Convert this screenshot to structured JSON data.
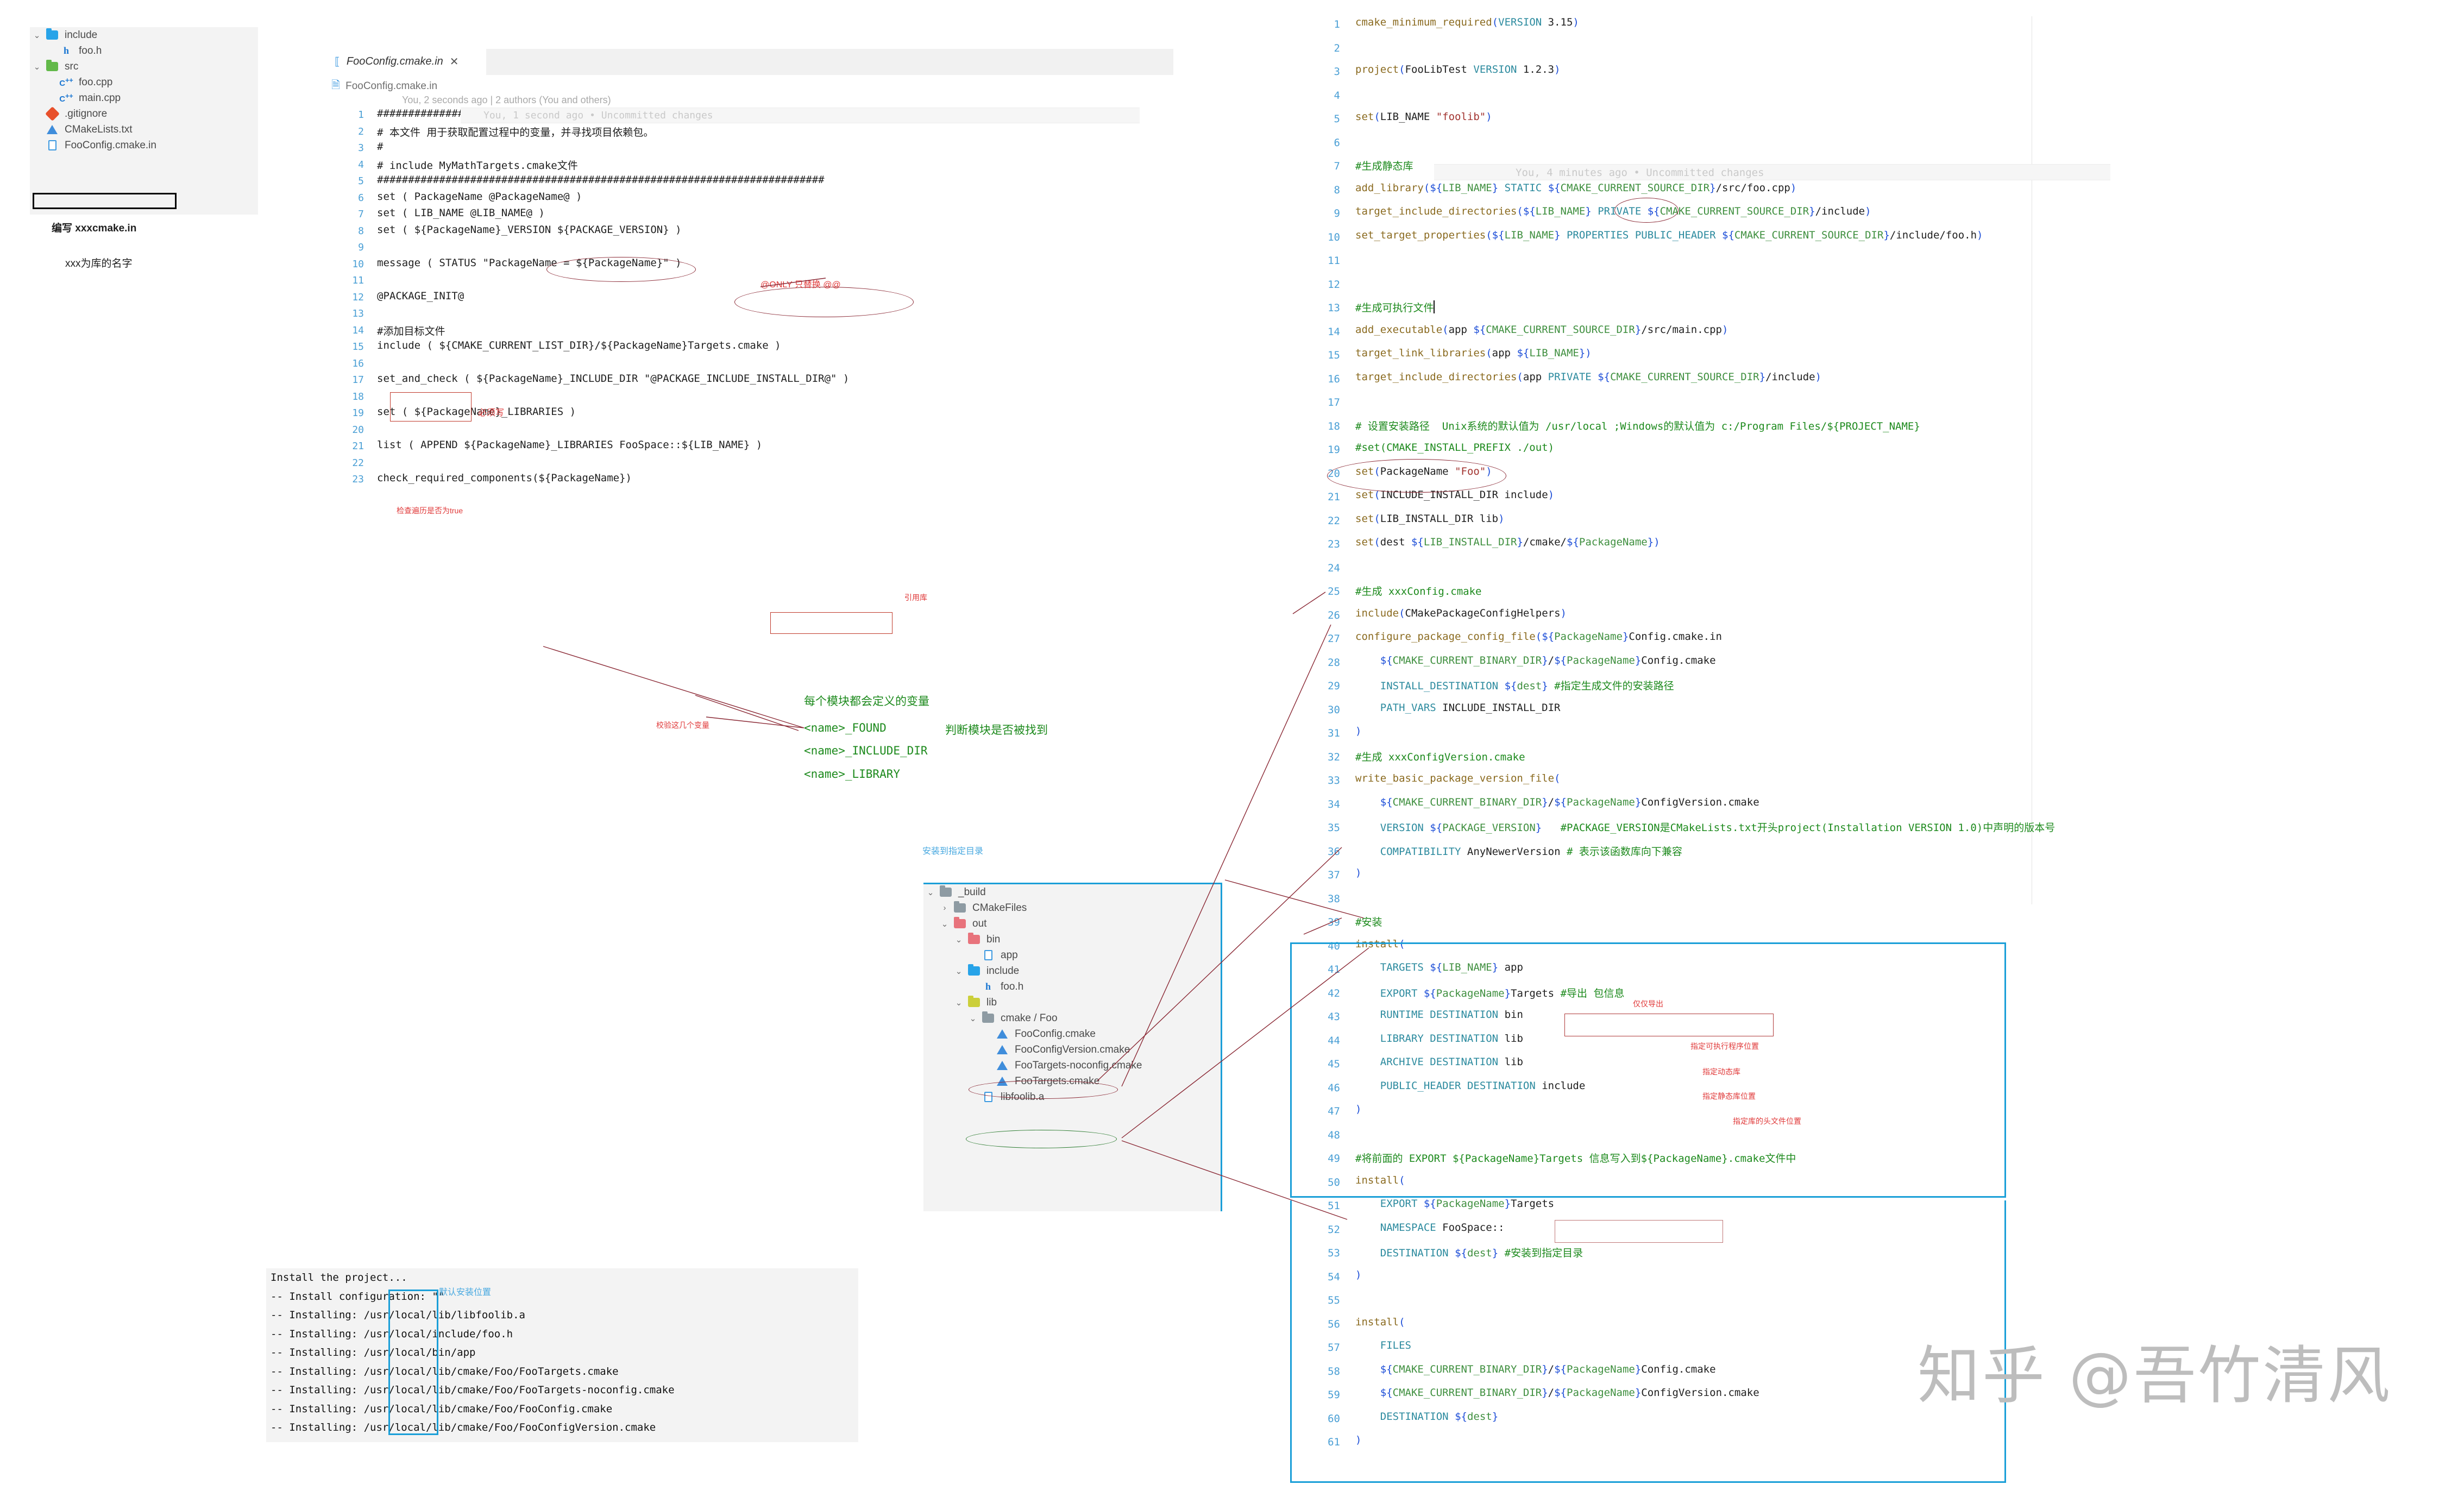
{
  "explorer": {
    "items": [
      {
        "label": "include",
        "icon": "folder-blue-icon",
        "twisty": "chevron-down",
        "indent": 1
      },
      {
        "label": "foo.h",
        "icon": "h-file-icon",
        "twisty": "",
        "indent": 2
      },
      {
        "label": "src",
        "icon": "folder-green-icon",
        "twisty": "chevron-down",
        "indent": 1
      },
      {
        "label": "foo.cpp",
        "icon": "cpp-file-icon",
        "twisty": "",
        "indent": 2
      },
      {
        "label": "main.cpp",
        "icon": "cpp-file-icon",
        "twisty": "",
        "indent": 2
      },
      {
        "label": ".gitignore",
        "icon": "git-icon",
        "twisty": "",
        "indent": 1
      },
      {
        "label": "CMakeLists.txt",
        "icon": "cmake-icon",
        "twisty": "",
        "indent": 1
      },
      {
        "label": "FooConfig.cmake.in",
        "icon": "file-icon",
        "twisty": "",
        "indent": 1
      }
    ],
    "annotation_write": "编写  xxxcmake.in",
    "annotation_name": "xxx为库的名字"
  },
  "left_editor": {
    "tab_label": "FooConfig.cmake.in",
    "tab_close": "✕",
    "breadcrumb": "FooConfig.cmake.in",
    "blame_header": "You, 2 seconds ago | 2 authors (You and others)",
    "blame_inline_line9": "You, 1 second ago • Uncommitted changes",
    "lines": [
      {
        "n": "1",
        "t": "########################################################################"
      },
      {
        "n": "2",
        "t": "# 本文件 用于获取配置过程中的变量，并寻找项目依赖包。"
      },
      {
        "n": "3",
        "t": "#"
      },
      {
        "n": "4",
        "t": "# include MyMathTargets.cmake文件"
      },
      {
        "n": "5",
        "t": "########################################################################"
      },
      {
        "n": "6",
        "t": "set ( PackageName @PackageName@ )"
      },
      {
        "n": "7",
        "t": "set ( LIB_NAME @LIB_NAME@ )"
      },
      {
        "n": "8",
        "t": "set ( ${PackageName}_VERSION ${PACKAGE_VERSION} )"
      },
      {
        "n": "9",
        "t": ""
      },
      {
        "n": "10",
        "t": "message ( STATUS \"PackageName = ${PackageName}\" )"
      },
      {
        "n": "11",
        "t": ""
      },
      {
        "n": "12",
        "t": "@PACKAGE_INIT@"
      },
      {
        "n": "13",
        "t": ""
      },
      {
        "n": "14",
        "t": "#添加目标文件"
      },
      {
        "n": "15",
        "t": "include ( ${CMAKE_CURRENT_LIST_DIR}/${PackageName}Targets.cmake )"
      },
      {
        "n": "16",
        "t": ""
      },
      {
        "n": "17",
        "t": "set_and_check ( ${PackageName}_INCLUDE_DIR \"@PACKAGE_INCLUDE_INSTALL_DIR@\" )"
      },
      {
        "n": "18",
        "t": ""
      },
      {
        "n": "19",
        "t": "set ( ${PackageName}_LIBRARIES )"
      },
      {
        "n": "20",
        "t": ""
      },
      {
        "n": "21",
        "t": "list ( APPEND ${PackageName}_LIBRARIES FooSpace::${LIB_NAME} )"
      },
      {
        "n": "22",
        "t": ""
      },
      {
        "n": "23",
        "t": "check_required_components(${PackageName})"
      }
    ],
    "annotations": {
      "at_only": "@ONLY 只替换 @@",
      "must_write": "必须写",
      "check_true": "检查遍历是否为true",
      "ref_lib": "引用库"
    }
  },
  "middle_notes": {
    "validate_vars": "校验这几个变量",
    "every_module_title": "每个模块都会定义的变量",
    "var_found": "<name>_FOUND",
    "var_found_desc": "判断模块是否被找到",
    "var_include_dir": "<name>_INCLUDE_DIR",
    "var_library": "<name>_LIBRARY",
    "install_dest_note": "安装到指定目录"
  },
  "mid_tree": {
    "items": [
      {
        "label": "_build",
        "icon": "folder-grey-icon",
        "twisty": "chevron-down",
        "indent": 1
      },
      {
        "label": "CMakeFiles",
        "icon": "folder-grey-icon",
        "twisty": "chevron-right",
        "indent": 2
      },
      {
        "label": "out",
        "icon": "folder-red-icon",
        "twisty": "chevron-down",
        "indent": 2
      },
      {
        "label": "bin",
        "icon": "folder-red-icon",
        "twisty": "chevron-down",
        "indent": 3
      },
      {
        "label": "app",
        "icon": "file-icon",
        "twisty": "",
        "indent": 4
      },
      {
        "label": "include",
        "icon": "folder-blue-icon",
        "twisty": "chevron-down",
        "indent": 3
      },
      {
        "label": "foo.h",
        "icon": "h-file-icon",
        "twisty": "",
        "indent": 4
      },
      {
        "label": "lib",
        "icon": "folder-yellow-icon",
        "twisty": "chevron-down",
        "indent": 3
      },
      {
        "label": "cmake / Foo",
        "icon": "folder-grey-icon",
        "twisty": "chevron-down",
        "indent": 4
      },
      {
        "label": "FooConfig.cmake",
        "icon": "cmake-icon",
        "twisty": "",
        "indent": 5
      },
      {
        "label": "FooConfigVersion.cmake",
        "icon": "cmake-icon",
        "twisty": "",
        "indent": 5
      },
      {
        "label": "FooTargets-noconfig.cmake",
        "icon": "cmake-icon",
        "twisty": "",
        "indent": 5
      },
      {
        "label": "FooTargets.cmake",
        "icon": "cmake-icon",
        "twisty": "",
        "indent": 5
      },
      {
        "label": "libfoolib.a",
        "icon": "file-icon",
        "twisty": "",
        "indent": 4
      }
    ]
  },
  "terminal": {
    "lines": [
      "Install the project...",
      "-- Install configuration: \"\"",
      "-- Installing: /usr/local/lib/libfoolib.a",
      "-- Installing: /usr/local/include/foo.h",
      "-- Installing: /usr/local/bin/app",
      "-- Installing: /usr/local/lib/cmake/Foo/FooTargets.cmake",
      "-- Installing: /usr/local/lib/cmake/Foo/FooTargets-noconfig.cmake",
      "-- Installing: /usr/local/lib/cmake/Foo/FooConfig.cmake",
      "-- Installing: /usr/local/lib/cmake/Foo/FooConfigVersion.cmake"
    ],
    "default_path_note": "默认安装位置"
  },
  "right_editor": {
    "blame_inline_line13": "You, 4 minutes ago • Uncommitted changes",
    "lines": [
      {
        "n": "1",
        "t": "cmake_minimum_required(VERSION 3.15)"
      },
      {
        "n": "2",
        "t": ""
      },
      {
        "n": "3",
        "t": "project(FooLibTest VERSION 1.2.3)"
      },
      {
        "n": "4",
        "t": ""
      },
      {
        "n": "5",
        "t": "set(LIB_NAME \"foolib\")"
      },
      {
        "n": "6",
        "t": ""
      },
      {
        "n": "7",
        "t": "#生成静态库"
      },
      {
        "n": "8",
        "t": "add_library(${LIB_NAME} STATIC ${CMAKE_CURRENT_SOURCE_DIR}/src/foo.cpp)"
      },
      {
        "n": "9",
        "t": "target_include_directories(${LIB_NAME} PRIVATE ${CMAKE_CURRENT_SOURCE_DIR}/include)"
      },
      {
        "n": "10",
        "t": "set_target_properties(${LIB_NAME} PROPERTIES PUBLIC_HEADER ${CMAKE_CURRENT_SOURCE_DIR}/include/foo.h)"
      },
      {
        "n": "11",
        "t": ""
      },
      {
        "n": "12",
        "t": ""
      },
      {
        "n": "13",
        "t": "#生成可执行文件"
      },
      {
        "n": "14",
        "t": "add_executable(app ${CMAKE_CURRENT_SOURCE_DIR}/src/main.cpp)"
      },
      {
        "n": "15",
        "t": "target_link_libraries(app ${LIB_NAME})"
      },
      {
        "n": "16",
        "t": "target_include_directories(app PRIVATE ${CMAKE_CURRENT_SOURCE_DIR}/include)"
      },
      {
        "n": "17",
        "t": ""
      },
      {
        "n": "18",
        "t": "# 设置安装路径  Unix系统的默认值为 /usr/local ;Windows的默认值为 c:/Program Files/${PROJECT_NAME}"
      },
      {
        "n": "19",
        "t": "#set(CMAKE_INSTALL_PREFIX ./out)"
      },
      {
        "n": "20",
        "t": "set(PackageName \"Foo\")"
      },
      {
        "n": "21",
        "t": "set(INCLUDE_INSTALL_DIR include)"
      },
      {
        "n": "22",
        "t": "set(LIB_INSTALL_DIR lib)"
      },
      {
        "n": "23",
        "t": "set(dest ${LIB_INSTALL_DIR}/cmake/${PackageName})"
      },
      {
        "n": "24",
        "t": ""
      },
      {
        "n": "25",
        "t": "#生成 xxxConfig.cmake"
      },
      {
        "n": "26",
        "t": "include(CMakePackageConfigHelpers)"
      },
      {
        "n": "27",
        "t": "configure_package_config_file(${PackageName}Config.cmake.in"
      },
      {
        "n": "28",
        "t": "    ${CMAKE_CURRENT_BINARY_DIR}/${PackageName}Config.cmake"
      },
      {
        "n": "29",
        "t": "    INSTALL_DESTINATION ${dest} #指定生成文件的安装路径"
      },
      {
        "n": "30",
        "t": "    PATH_VARS INCLUDE_INSTALL_DIR"
      },
      {
        "n": "31",
        "t": ")"
      },
      {
        "n": "32",
        "t": "#生成 xxxConfigVersion.cmake"
      },
      {
        "n": "33",
        "t": "write_basic_package_version_file("
      },
      {
        "n": "34",
        "t": "    ${CMAKE_CURRENT_BINARY_DIR}/${PackageName}ConfigVersion.cmake"
      },
      {
        "n": "35",
        "t": "    VERSION ${PACKAGE_VERSION}   #PACKAGE_VERSION是CMakeLists.txt开头project(Installation VERSION 1.0)中声明的版本号"
      },
      {
        "n": "36",
        "t": "    COMPATIBILITY AnyNewerVersion # 表示该函数库向下兼容"
      },
      {
        "n": "37",
        "t": ")"
      },
      {
        "n": "38",
        "t": ""
      },
      {
        "n": "39",
        "t": "#安装"
      },
      {
        "n": "40",
        "t": "install("
      },
      {
        "n": "41",
        "t": "    TARGETS ${LIB_NAME} app"
      },
      {
        "n": "42",
        "t": "    EXPORT ${PackageName}Targets #导出 包信息"
      },
      {
        "n": "43",
        "t": "    RUNTIME DESTINATION bin"
      },
      {
        "n": "44",
        "t": "    LIBRARY DESTINATION lib"
      },
      {
        "n": "45",
        "t": "    ARCHIVE DESTINATION lib"
      },
      {
        "n": "46",
        "t": "    PUBLIC_HEADER DESTINATION include"
      },
      {
        "n": "47",
        "t": ")"
      },
      {
        "n": "48",
        "t": ""
      },
      {
        "n": "49",
        "t": "#将前面的 EXPORT ${PackageName}Targets 信息写入到${PackageName}.cmake文件中"
      },
      {
        "n": "50",
        "t": "install("
      },
      {
        "n": "51",
        "t": "    EXPORT ${PackageName}Targets"
      },
      {
        "n": "52",
        "t": "    NAMESPACE FooSpace::"
      },
      {
        "n": "53",
        "t": "    DESTINATION ${dest} #安装到指定目录"
      },
      {
        "n": "54",
        "t": ")"
      },
      {
        "n": "55",
        "t": ""
      },
      {
        "n": "56",
        "t": "install("
      },
      {
        "n": "57",
        "t": "    FILES"
      },
      {
        "n": "58",
        "t": "    ${CMAKE_CURRENT_BINARY_DIR}/${PackageName}Config.cmake"
      },
      {
        "n": "59",
        "t": "    ${CMAKE_CURRENT_BINARY_DIR}/${PackageName}ConfigVersion.cmake"
      },
      {
        "n": "60",
        "t": "    DESTINATION ${dest}"
      },
      {
        "n": "61",
        "t": ")"
      }
    ],
    "annotations": {
      "only_export": "仅仅导出",
      "runtime_note": "指定可执行程序位置",
      "library_note": "指定动态库",
      "archive_note": "指定静态库位置",
      "public_header_note": "指定库的头文件位置"
    }
  },
  "watermark": "知乎 @吾竹清风",
  "colors": {
    "accent_blue": "#1b9fd8",
    "red_annotation": "#e03a3a",
    "green_comment": "#1d8a1d",
    "ellipse_red": "#8b2a36",
    "ellipse_green": "#2e7d32",
    "linenum_blue": "#4a9fd5",
    "panel_grey": "#f3f3f3"
  }
}
